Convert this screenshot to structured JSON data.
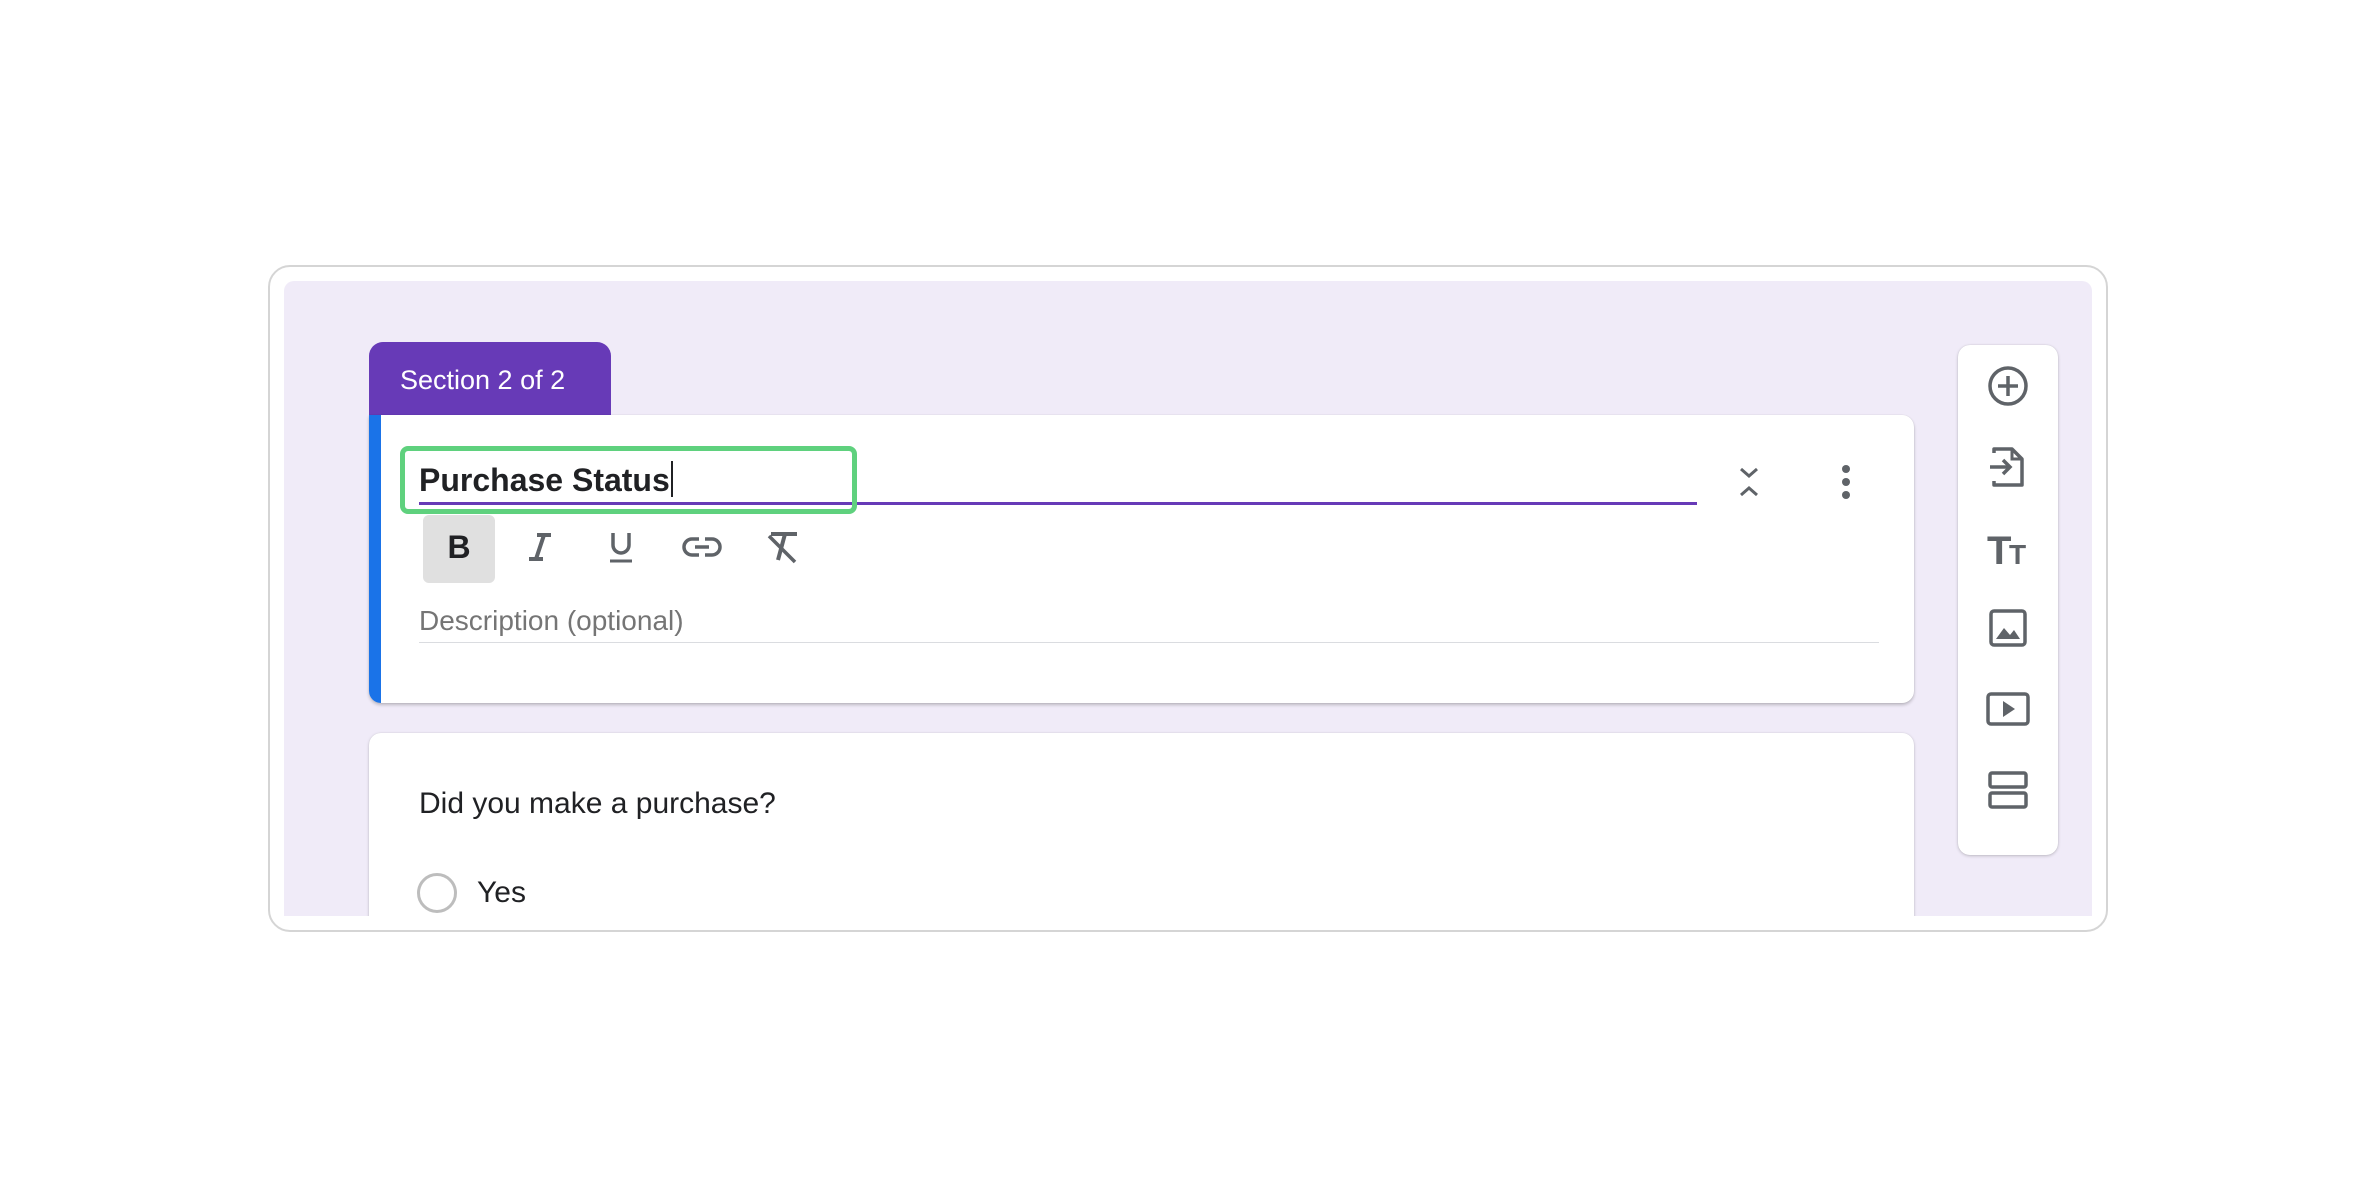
{
  "section_tab": {
    "label": "Section 2 of 2"
  },
  "header": {
    "title_value": "Purchase Status",
    "description_placeholder": "Description (optional)",
    "collapse_icon": "unfold-less-icon",
    "more_icon": "more-vert-icon"
  },
  "format_toolbar": {
    "items": [
      {
        "name": "bold",
        "icon": "bold-icon",
        "active": true
      },
      {
        "name": "italic",
        "icon": "italic-icon",
        "active": false
      },
      {
        "name": "underline",
        "icon": "underline-icon",
        "active": false
      },
      {
        "name": "link",
        "icon": "link-icon",
        "active": false
      },
      {
        "name": "clear-formatting",
        "icon": "clear-format-icon",
        "active": false
      }
    ]
  },
  "question": {
    "title": "Did you make a purchase?",
    "options": [
      {
        "label": "Yes"
      }
    ]
  },
  "side_toolbar": {
    "items": [
      {
        "name": "add-question",
        "icon": "add-circle-icon"
      },
      {
        "name": "import-questions",
        "icon": "import-file-icon"
      },
      {
        "name": "add-title-description",
        "icon": "title-text-icon"
      },
      {
        "name": "add-image",
        "icon": "image-icon"
      },
      {
        "name": "add-video",
        "icon": "video-icon"
      },
      {
        "name": "add-section",
        "icon": "section-icon"
      }
    ]
  },
  "colors": {
    "accent_purple": "#673ab7",
    "canvas_bg": "#f0ebf8",
    "card_left_accent": "#1a73e8",
    "highlight_green": "#5fd17e",
    "icon_gray": "#5f6368"
  }
}
